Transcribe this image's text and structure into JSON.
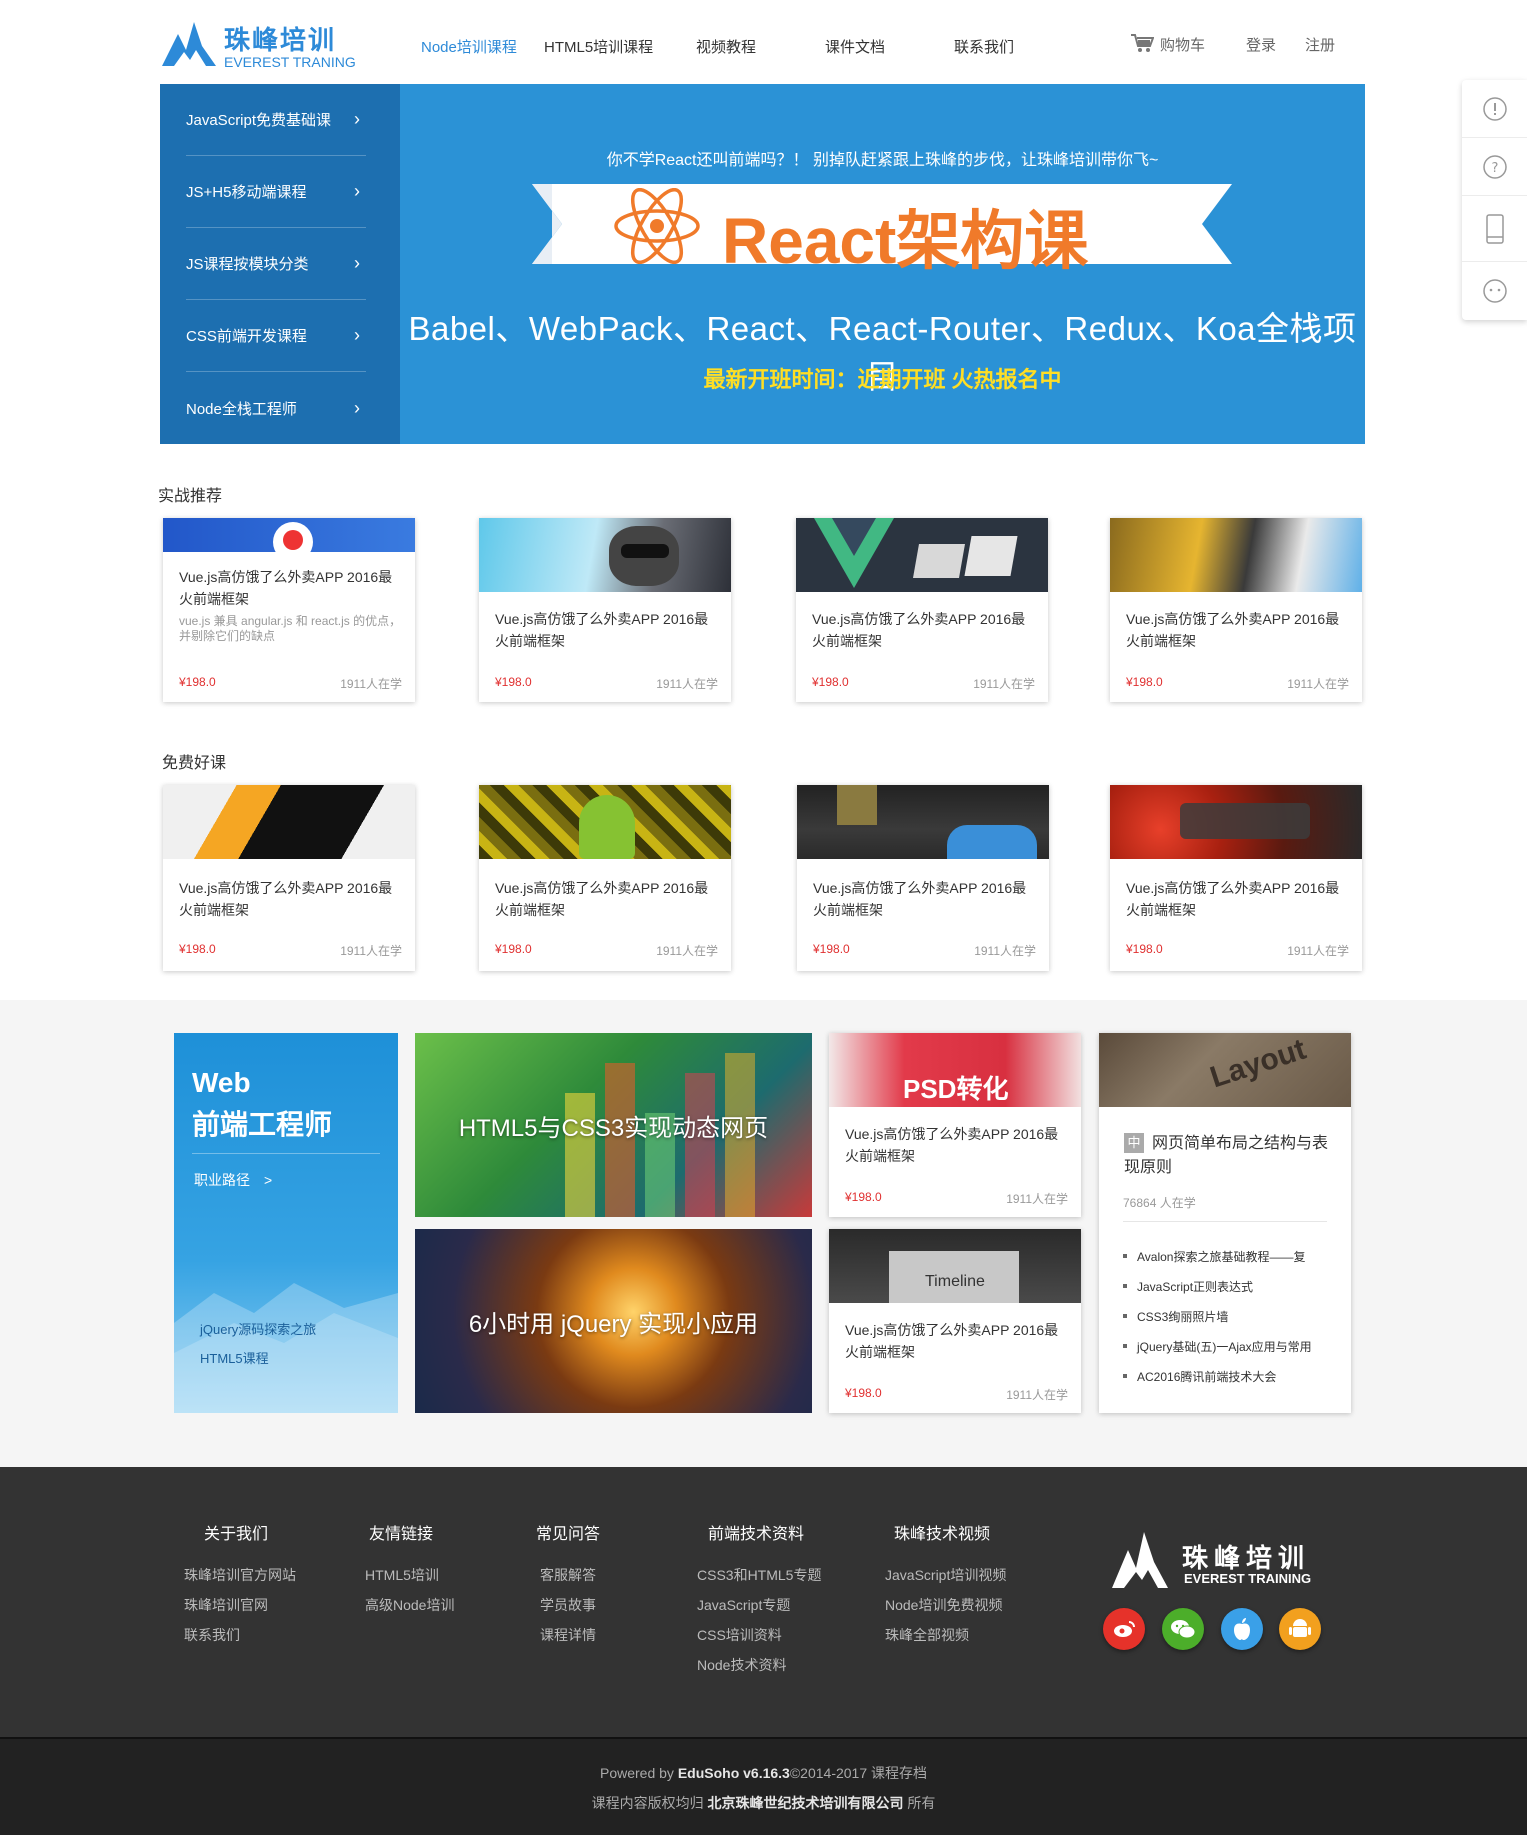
{
  "header": {
    "logo_cn": "珠峰培训",
    "logo_en": "EVEREST TRANING",
    "nav": [
      "Node培训课程",
      "HTML5培训课程",
      "视频教程",
      "课件文档",
      "联系我们"
    ],
    "cart": "购物车",
    "login": "登录",
    "register": "注册"
  },
  "sidetools": [
    "info-icon",
    "question-icon",
    "mobile-icon",
    "chat-icon"
  ],
  "sidemenu": [
    "JavaScript免费基础课",
    "JS+H5移动端课程",
    "JS课程按模块分类",
    "CSS前端开发课程",
    "Node全栈工程师"
  ],
  "banner": {
    "top": "你不学React还叫前端吗？！ 别掉队赶紧跟上珠峰的步伐，让珠峰培训带你飞~",
    "title": "React架构课",
    "main": "Babel、WebPack、React、React-Router、Redux、Koa全栈项目",
    "sub": "最新开班时间：近期开班 火热报名中"
  },
  "section1": {
    "title": "实战推荐",
    "cards": [
      {
        "title": "Vue.js高仿饿了么外卖APP 2016最火前端框架",
        "desc": "vue.js 兼具 angular.js 和 react.js 的优点，并剔除它们的缺点",
        "price": "¥198.0",
        "students": "1911人在学"
      },
      {
        "title": "Vue.js高仿饿了么外卖APP 2016最火前端框架",
        "price": "¥198.0",
        "students": "1911人在学"
      },
      {
        "title": "Vue.js高仿饿了么外卖APP 2016最火前端框架",
        "price": "¥198.0",
        "students": "1911人在学"
      },
      {
        "title": "Vue.js高仿饿了么外卖APP 2016最火前端框架",
        "price": "¥198.0",
        "students": "1911人在学"
      }
    ]
  },
  "section2": {
    "title": "免费好课",
    "cards": [
      {
        "title": "Vue.js高仿饿了么外卖APP 2016最火前端框架",
        "price": "¥198.0",
        "students": "1911人在学"
      },
      {
        "title": "Vue.js高仿饿了么外卖APP 2016最火前端框架",
        "price": "¥198.0",
        "students": "1911人在学"
      },
      {
        "title": "Vue.js高仿饿了么外卖APP 2016最火前端框架",
        "price": "¥198.0",
        "students": "1911人在学"
      },
      {
        "title": "Vue.js高仿饿了么外卖APP 2016最火前端框架",
        "price": "¥198.0",
        "students": "1911人在学"
      }
    ]
  },
  "path": {
    "title1": "Web",
    "title2": "前端工程师",
    "link": "职业路径　>",
    "items": [
      "jQuery源码探索之旅",
      "HTML5课程"
    ]
  },
  "tiles": [
    "HTML5与CSS3实现动态网页",
    "6小时用 jQuery 实现小应用"
  ],
  "small_cards": [
    {
      "thumb_text": "PSD转化",
      "title": "Vue.js高仿饿了么外卖APP 2016最火前端框架",
      "price": "¥198.0",
      "students": "1911人在学"
    },
    {
      "thumb_text": "Timeline",
      "title": "Vue.js高仿饿了么外卖APP 2016最火前端框架",
      "price": "¥198.0",
      "students": "1911人在学"
    }
  ],
  "list_card": {
    "thumb_text": "Layout",
    "badge": "中",
    "title": "网页简单布局之结构与表现原则",
    "students": "76864 人在学",
    "items": [
      "Avalon探索之旅基础教程——复",
      "JavaScript正则表达式",
      "CSS3绚丽照片墙",
      "jQuery基础(五)一Ajax应用与常用",
      "AC2016腾讯前端技术大会"
    ]
  },
  "footer": {
    "cols": [
      {
        "title": "关于我们",
        "links": [
          "珠峰培训官方网站",
          "珠峰培训官网",
          "联系我们"
        ]
      },
      {
        "title": "友情链接",
        "links": [
          "HTML5培训",
          "高级Node培训"
        ]
      },
      {
        "title": "常见问答",
        "links": [
          "客服解答",
          "学员故事",
          "课程详情"
        ]
      },
      {
        "title": "前端技术资料",
        "links": [
          "CSS3和HTML5专题",
          "JavaScript专题",
          "CSS培训资料",
          "Node技术资料"
        ]
      },
      {
        "title": "珠峰技术视频",
        "links": [
          "JavaScript培训视频",
          "Node培训免费视频",
          "珠峰全部视频"
        ]
      }
    ],
    "logo_cn": "珠峰培训",
    "logo_en": "EVEREST TRAINING",
    "social": [
      {
        "name": "weibo-icon",
        "color": "#e6322a"
      },
      {
        "name": "wechat-icon",
        "color": "#4cae2a"
      },
      {
        "name": "apple-icon",
        "color": "#3aa0e8"
      },
      {
        "name": "android-icon",
        "color": "#f2a01e"
      }
    ]
  },
  "bottom": {
    "powered": "Powered by",
    "brand": "EduSoho v6.16.3",
    "copy": "©2014-2017 课程存档",
    "owner_pre": "课程内容版权均归",
    "owner": "北京珠峰世纪技术培训有限公司",
    "owner_post": "所有"
  }
}
